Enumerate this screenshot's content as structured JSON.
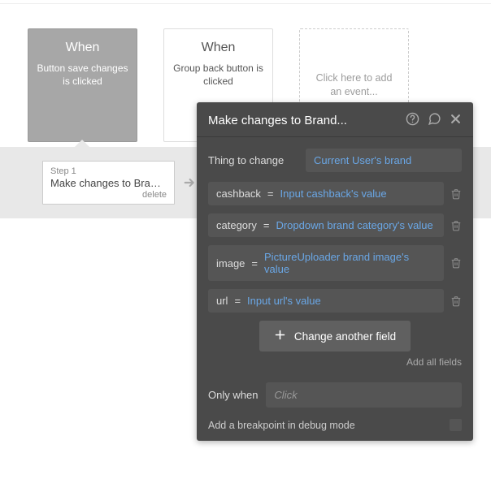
{
  "events": {
    "items": [
      {
        "when": "When",
        "desc": "Button save changes is clicked"
      },
      {
        "when": "When",
        "desc": "Group back button is clicked"
      }
    ],
    "add_placeholder": "Click here to add an event..."
  },
  "step": {
    "label": "Step 1",
    "title": "Make changes to Brand...",
    "delete": "delete"
  },
  "panel": {
    "title": "Make changes to Brand...",
    "thing_to_change_label": "Thing to change",
    "thing_to_change_value": "Current User's brand",
    "fields": [
      {
        "key": "cashback",
        "eq": "=",
        "val": "Input cashback's value"
      },
      {
        "key": "category",
        "eq": "=",
        "val": "Dropdown brand category's value"
      },
      {
        "key": "image",
        "eq": "=",
        "val": "PictureUploader brand image's value"
      },
      {
        "key": "url",
        "eq": "=",
        "val": "Input url's value"
      }
    ],
    "change_another": "Change another field",
    "add_all": "Add all fields",
    "only_when_label": "Only when",
    "only_when_placeholder": "Click",
    "breakpoint_label": "Add a breakpoint in debug mode"
  }
}
